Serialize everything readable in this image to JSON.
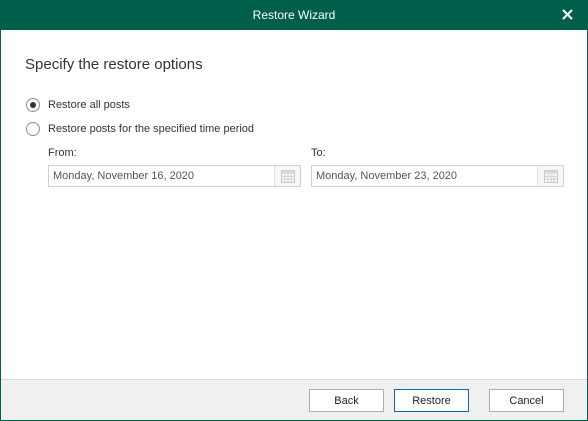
{
  "window": {
    "title": "Restore Wizard"
  },
  "page": {
    "heading": "Specify the restore options"
  },
  "options": {
    "all_posts_label": "Restore all posts",
    "period_label": "Restore posts for the specified time period",
    "selected": "all_posts"
  },
  "period": {
    "from_label": "From:",
    "from_value": "Monday, November 16, 2020",
    "to_label": "To:",
    "to_value": "Monday, November 23, 2020",
    "enabled": false
  },
  "buttons": {
    "back": "Back",
    "restore": "Restore",
    "cancel": "Cancel"
  },
  "colors": {
    "titlebar": "#005f4b",
    "default_button_border": "#0a6cb6",
    "footer": "#f0f0f0"
  },
  "icons": {
    "close": "close-icon",
    "calendar": "calendar-icon"
  }
}
